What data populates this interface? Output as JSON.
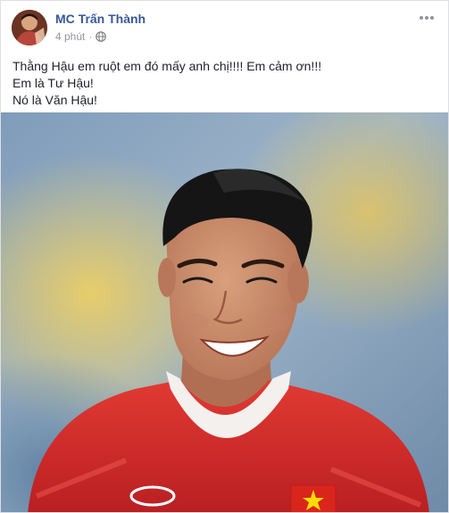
{
  "post": {
    "author": "MC Trấn Thành",
    "time": "4 phút",
    "separator": "·",
    "privacy_icon": "globe-icon",
    "menu_icon": "more-options-icon",
    "lines": [
      "Thằng Hậu em ruột em đó mấy anh chị!!!! Em cảm ơn!!!",
      "Em là Tư Hậu!",
      "Nó là Văn Hậu!"
    ],
    "photo": {
      "subject": "smiling-football-player-photo",
      "colors": {
        "jersey": "#d8292a",
        "background": "#8aa7c4",
        "hair": "#141414",
        "skin": "#c98a68"
      }
    }
  },
  "colors": {
    "author_link": "#365899",
    "meta_text": "#90949c",
    "body_text": "#1d2129",
    "border": "#dddfe2"
  }
}
